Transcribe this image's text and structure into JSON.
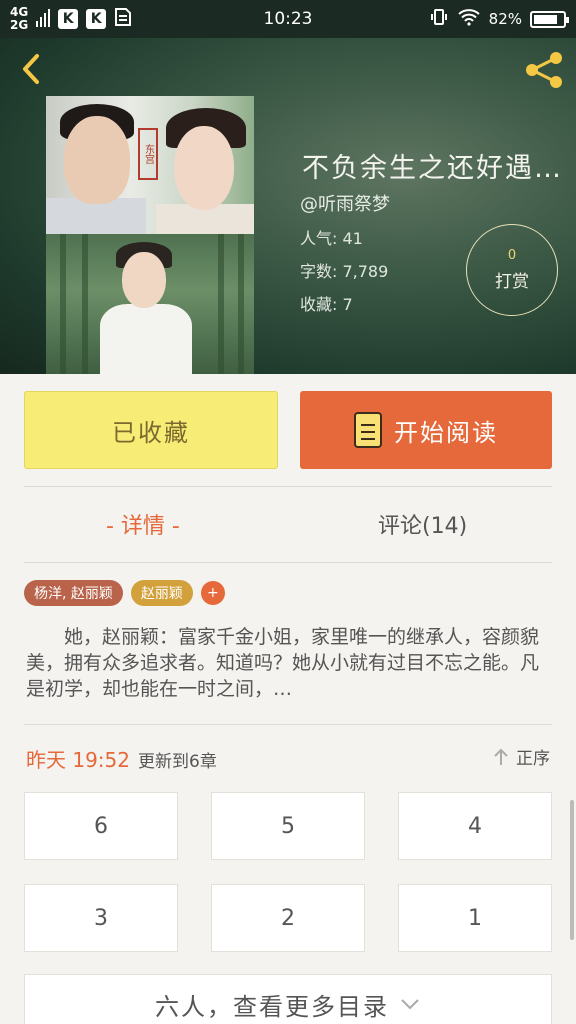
{
  "status_bar": {
    "network_top": "4G",
    "network_bottom": "2G",
    "app_icon_1": "K",
    "app_icon_2": "K",
    "time": "10:23",
    "battery": "82%",
    "battery_level": 0.82,
    "icons": [
      "signal-icon",
      "vibrate-icon",
      "wifi-icon",
      "battery-icon"
    ]
  },
  "header": {
    "back_icon": "chevron-left-icon",
    "share_icon": "share-icon",
    "accent_color": "#f4c844"
  },
  "book": {
    "title": "不负余生之还好遇…",
    "author": "@听雨祭梦",
    "popularity": "人气: 41",
    "word_count": "字数: 7,789",
    "favorites": "收藏: 7",
    "cover_seal": "东宫"
  },
  "tip": {
    "count": "0",
    "label": "打赏"
  },
  "actions": {
    "collect_label": "已收藏",
    "read_label": "开始阅读",
    "collect_color": "#f7ec75",
    "read_color": "#e5693a"
  },
  "tabs": {
    "detail": "- 详情 -",
    "comments": "评论(14)"
  },
  "tags": {
    "items": [
      "杨洋, 赵丽颖",
      "赵丽颖"
    ],
    "add": "+"
  },
  "description": "她，赵丽颖：富家千金小姐，家里唯一的继承人，容颜貌美，拥有众多追求者。知道吗？她从小就有过目不忘之能。凡是初学，却也能在一时之间，…",
  "update": {
    "time": "昨天 19:52",
    "text": "更新到6章",
    "sort_label": "正序",
    "sort_icon": "arrow-up-icon"
  },
  "chapters": [
    "6",
    "5",
    "4",
    "3",
    "2",
    "1"
  ],
  "more": {
    "label": "六人，查看更多目录",
    "icon": "chevron-down-icon"
  }
}
